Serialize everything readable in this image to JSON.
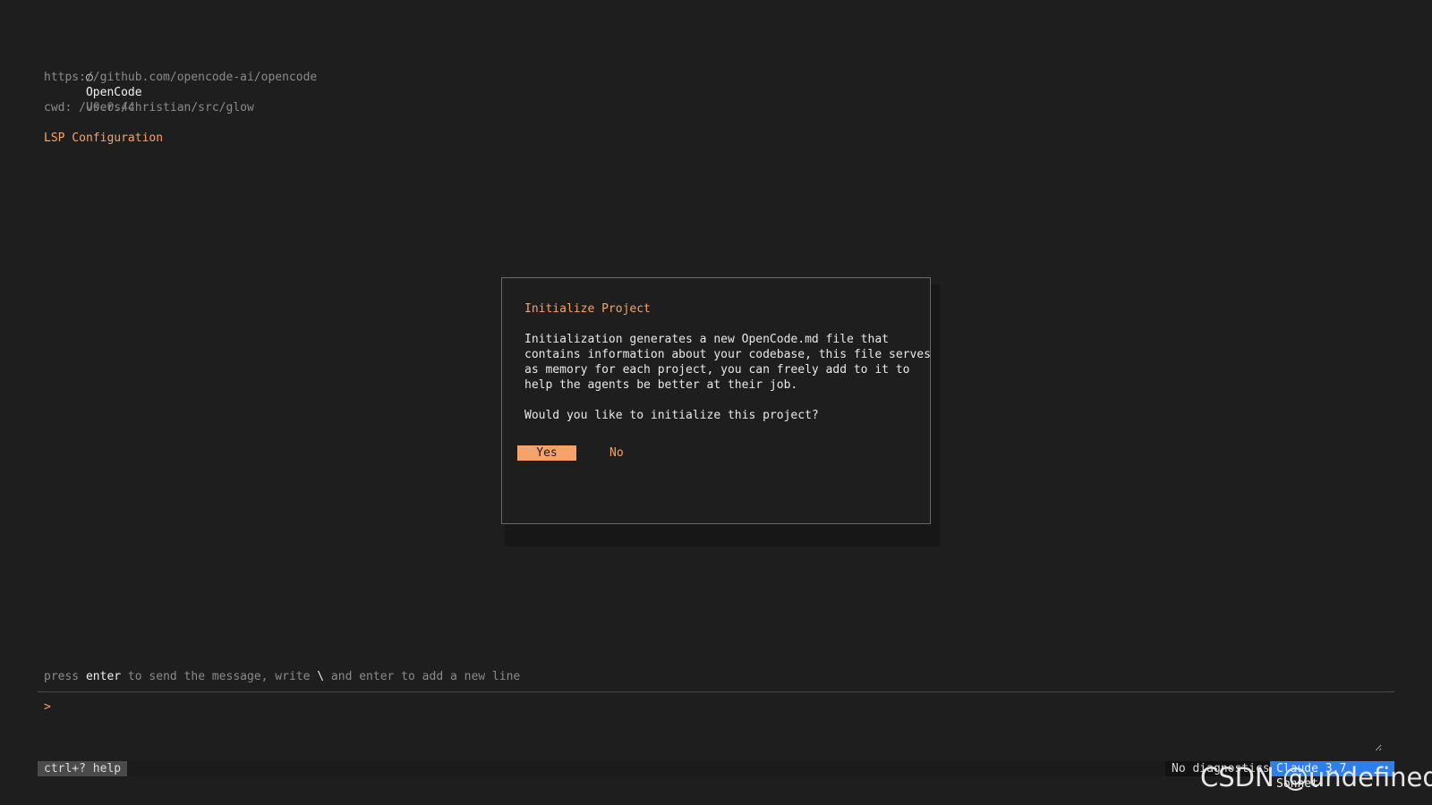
{
  "header": {
    "logo_glyph": "○",
    "app_name": "OpenCode",
    "version": "v0.0.44",
    "url": "https://github.com/opencode-ai/opencode",
    "cwd": "cwd: /Users/christian/src/glow",
    "lsp_heading": "LSP Configuration"
  },
  "dialog": {
    "title": "Initialize Project",
    "body": "Initialization generates a new OpenCode.md file that\ncontains information about your codebase, this file serves\nas memory for each project, you can freely add to it to\nhelp the agents be better at their job.",
    "question": "Would you like to initialize this project?",
    "yes_label": "Yes",
    "no_label": "No"
  },
  "input": {
    "hint_prefix": "press ",
    "hint_key": "enter",
    "hint_middle": " to send the message, write ",
    "hint_escape": "\\",
    "hint_suffix": " and enter to add a new line",
    "prompt_glyph": ">",
    "value": ""
  },
  "statusbar": {
    "help": "ctrl+? help",
    "diagnostics": "No diagnostics",
    "model": "Claude 3.7 Sonnet"
  },
  "watermark": "CSDN @undefined",
  "colors": {
    "accent": "#f5a36b",
    "model_badge": "#2d7ff0",
    "background": "#1e1e1e"
  }
}
